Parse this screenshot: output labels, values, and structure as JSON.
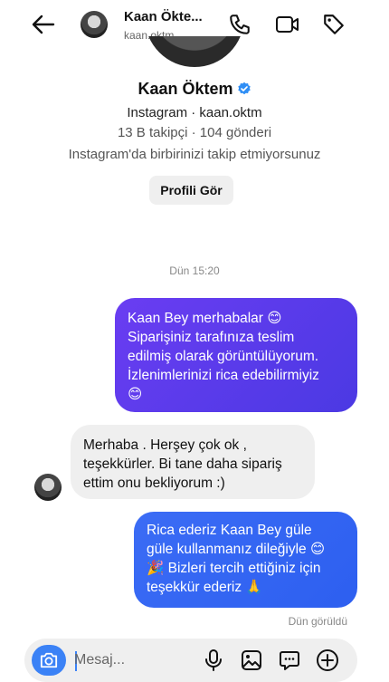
{
  "header": {
    "display_name": "Kaan Ökte...",
    "username": "kaan.oktm"
  },
  "profile": {
    "name": "Kaan Öktem",
    "source_line": "Instagram · kaan.oktm",
    "stats_line": "13 B takipçi · 104 gönderi",
    "relation_line": "Instagram'da birbirinizi takip etmiyorsunuz",
    "view_profile_label": "Profili Gör"
  },
  "thread": {
    "timestamp": "Dün 15:20",
    "messages": [
      {
        "direction": "outgoing",
        "lines": [
          "Kaan Bey merhabalar 😊",
          "Siparişiniz tarafınıza teslim",
          "edilmiş olarak görüntülüyorum.",
          "İzlenimlerinizi rica edebilirmiyiz",
          "😊"
        ]
      },
      {
        "direction": "incoming",
        "lines": [
          "Merhaba . Herşey çok ok ,",
          "teşekkürler. Bi tane daha sipariş",
          "ettim onu bekliyorum :)"
        ]
      },
      {
        "direction": "outgoing",
        "lines": [
          "Rica ederiz Kaan Bey güle",
          "güle kullanmanız dileğiyle 😊",
          "🎉 Bizleri tercih ettiğiniz için",
          "teşekkür ederiz 🙏"
        ]
      }
    ],
    "seen_label": "Dün görüldü"
  },
  "composer": {
    "placeholder": "Mesaj..."
  },
  "colors": {
    "accent_blue": "#3b82f6",
    "outgoing_purple": "#5a3ceb",
    "outgoing_blue": "#3367f3",
    "incoming_gray": "#efefef"
  },
  "icons": [
    "back-arrow-icon",
    "phone-icon",
    "video-icon",
    "tag-icon",
    "verified-badge-icon",
    "camera-icon",
    "microphone-icon",
    "gallery-icon",
    "sticker-icon",
    "plus-icon"
  ]
}
